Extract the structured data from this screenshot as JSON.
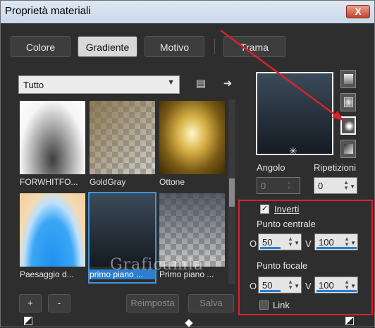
{
  "window": {
    "title": "Proprietà materiali",
    "close_label": "X"
  },
  "tabs": [
    {
      "label": "Colore",
      "active": false
    },
    {
      "label": "Gradiente",
      "active": true
    },
    {
      "label": "Motivo",
      "active": false
    },
    {
      "label": "Trama",
      "active": false
    }
  ],
  "filter": {
    "selected": "Tutto"
  },
  "toolbar_icons": [
    "page-icon",
    "arrow-right-icon"
  ],
  "gradients": [
    {
      "label": "FORWHITFO..."
    },
    {
      "label": "GoldGray"
    },
    {
      "label": "Ottone"
    },
    {
      "label": "Paesaggio d..."
    },
    {
      "label": "primo piano ...",
      "selected": true
    },
    {
      "label": "Primo piano ..."
    }
  ],
  "watermark": "Graficamia",
  "buttons": {
    "add": "+",
    "remove": "-",
    "reset": "Reimposta",
    "save": "Salva"
  },
  "style_buttons": [
    "linear-style-icon",
    "rectangular-style-icon",
    "radial-style-icon",
    "sunburst-style-icon"
  ],
  "angle": {
    "label": "Angolo",
    "value": "0"
  },
  "repeats": {
    "label": "Ripetizioni",
    "value": "0"
  },
  "invert": {
    "label": "Inverti",
    "checked": true
  },
  "center_point": {
    "label": "Punto centrale",
    "o_label": "O",
    "o_value": "50",
    "v_label": "V",
    "v_value": "100"
  },
  "focal_point": {
    "label": "Punto focale",
    "o_label": "O",
    "o_value": "50",
    "v_label": "V",
    "v_value": "100"
  },
  "link": {
    "label": "Link",
    "checked": false
  },
  "colors": {
    "accent": "#2a7fd0",
    "highlight": "#d9222a"
  }
}
